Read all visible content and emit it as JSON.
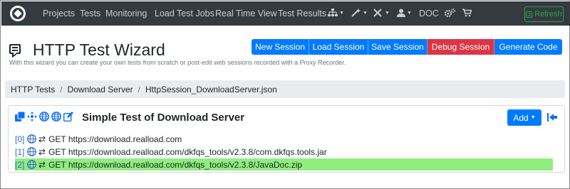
{
  "navbar": {
    "items": [
      "Projects",
      "Tests",
      "Monitoring",
      "Load Test Jobs",
      "Real Time View",
      "Test Results"
    ],
    "icons": [
      "sitemap-icon",
      "magic-wand-icon",
      "tools-icon",
      "user-icon"
    ],
    "doc_label": "DOC",
    "refresh_label": "Refresh"
  },
  "header": {
    "title": "HTTP Test Wizard",
    "subtitle": "With this wizard you can create your own tests from scratch or post-edit web sessions recorded with a Proxy Recorder."
  },
  "toolbar": {
    "buttons": [
      {
        "label": "New Session",
        "color": "#007bff"
      },
      {
        "label": "Load Session",
        "color": "#007bff"
      },
      {
        "label": "Save Session",
        "color": "#007bff"
      },
      {
        "label": "Debug Session",
        "color": "#dc3545"
      },
      {
        "label": "Generate Code",
        "color": "#007bff"
      }
    ]
  },
  "breadcrumb": [
    "HTTP Tests",
    "Download Server",
    "HttpSession_DownloadServer.json"
  ],
  "card": {
    "title": "Simple Test of Download Server",
    "add_label": "Add",
    "requests": [
      {
        "index": "[0]",
        "text": "GET https://download.realload.com",
        "selected": false
      },
      {
        "index": "[1]",
        "text": "GET https://download.realload.com/dkfqs_tools/v2.3.8/com.dkfqs.tools.jar",
        "selected": false
      },
      {
        "index": "[2]",
        "text": "GET https://download.realload.com/dkfqs_tools/v2.3.8/JavaDoc.zip",
        "selected": true
      }
    ]
  },
  "colors": {
    "navbar": "#343a40",
    "primary": "#007bff",
    "danger": "#dc3545",
    "success": "#28a745",
    "selected_row": "#90ee7f"
  }
}
